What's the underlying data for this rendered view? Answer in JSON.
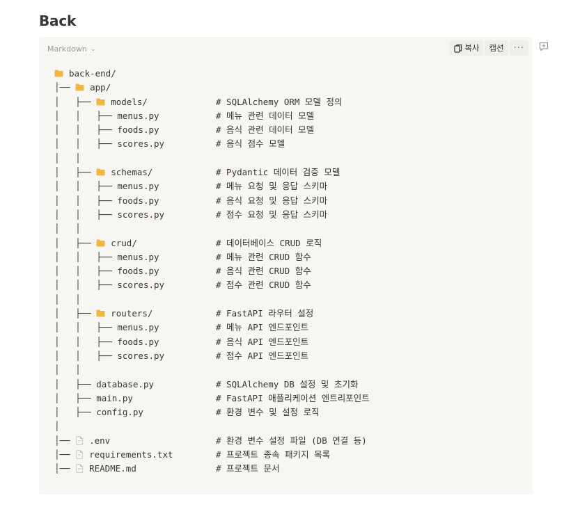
{
  "page": {
    "heading": "Back"
  },
  "code_block": {
    "language": "Markdown",
    "toolbar": {
      "copy_label": "복사",
      "caption_label": "캡션",
      "more_label": "···"
    },
    "lines": [
      {
        "prefix": "",
        "icon": "folder-icon",
        "name": "back-end/",
        "comment": ""
      },
      {
        "prefix": "│── ",
        "icon": "folder-icon",
        "name": "app/",
        "comment": ""
      },
      {
        "prefix": "│   ├── ",
        "icon": "folder-icon",
        "name": "models/",
        "comment": "# SQLAlchemy ORM 모델 정의"
      },
      {
        "prefix": "│   │   ├── ",
        "icon": "",
        "name": "menus.py",
        "comment": "# 메뉴 관련 데이터 모델"
      },
      {
        "prefix": "│   │   ├── ",
        "icon": "",
        "name": "foods.py",
        "comment": "# 음식 관련 데이터 모델"
      },
      {
        "prefix": "│   │   ├── ",
        "icon": "",
        "name": "scores.py",
        "comment": "# 음식 점수 모델"
      },
      {
        "prefix": "│   │",
        "icon": "",
        "name": "",
        "comment": ""
      },
      {
        "prefix": "│   ├── ",
        "icon": "folder-icon",
        "name": "schemas/",
        "comment": "# Pydantic 데이터 검증 모델"
      },
      {
        "prefix": "│   │   ├── ",
        "icon": "",
        "name": "menus.py",
        "comment": "# 메뉴 요청 및 응답 스키마"
      },
      {
        "prefix": "│   │   ├── ",
        "icon": "",
        "name": "foods.py",
        "comment": "# 음식 요청 및 응답 스키마"
      },
      {
        "prefix": "│   │   ├── ",
        "icon": "",
        "name": "scores.py",
        "comment": "# 점수 요청 및 응답 스키마"
      },
      {
        "prefix": "│   │",
        "icon": "",
        "name": "",
        "comment": ""
      },
      {
        "prefix": "│   ├── ",
        "icon": "folder-icon",
        "name": "crud/",
        "comment": "# 데이터베이스 CRUD 로직"
      },
      {
        "prefix": "│   │   ├── ",
        "icon": "",
        "name": "menus.py",
        "comment": "# 메뉴 관련 CRUD 함수"
      },
      {
        "prefix": "│   │   ├── ",
        "icon": "",
        "name": "foods.py",
        "comment": "# 음식 관련 CRUD 함수"
      },
      {
        "prefix": "│   │   ├── ",
        "icon": "",
        "name": "scores.py",
        "comment": "# 점수 관련 CRUD 함수"
      },
      {
        "prefix": "│   │",
        "icon": "",
        "name": "",
        "comment": ""
      },
      {
        "prefix": "│   ├── ",
        "icon": "folder-icon",
        "name": "routers/",
        "comment": "# FastAPI 라우터 설정"
      },
      {
        "prefix": "│   │   ├── ",
        "icon": "",
        "name": "menus.py",
        "comment": "# 메뉴 API 엔드포인트"
      },
      {
        "prefix": "│   │   ├── ",
        "icon": "",
        "name": "foods.py",
        "comment": "# 음식 API 엔드포인트"
      },
      {
        "prefix": "│   │   ├── ",
        "icon": "",
        "name": "scores.py",
        "comment": "# 점수 API 엔드포인트"
      },
      {
        "prefix": "│   │",
        "icon": "",
        "name": "",
        "comment": ""
      },
      {
        "prefix": "│   ├── ",
        "icon": "",
        "name": "database.py",
        "comment": "# SQLAlchemy DB 설정 및 초기화"
      },
      {
        "prefix": "│   ├── ",
        "icon": "",
        "name": "main.py",
        "comment": "# FastAPI 애플리케이션 엔트리포인트"
      },
      {
        "prefix": "│   ├── ",
        "icon": "",
        "name": "config.py",
        "comment": "# 환경 변수 및 설정 로직"
      },
      {
        "prefix": "│",
        "icon": "",
        "name": "",
        "comment": ""
      },
      {
        "prefix": "│── ",
        "icon": "file-icon",
        "name": ".env",
        "comment": "# 환경 변수 설정 파일 (DB 연결 등)"
      },
      {
        "prefix": "│── ",
        "icon": "file-icon",
        "name": "requirements.txt",
        "comment": "# 프로젝트 종속 패키지 목록"
      },
      {
        "prefix": "│── ",
        "icon": "file-icon",
        "name": "README.md",
        "comment": "# 프로젝트 문서"
      }
    ]
  },
  "colors": {
    "block_bg": "#f7f6f3",
    "folder": "#f2b544",
    "text": "#37352f",
    "muted": "#9b9a97"
  }
}
